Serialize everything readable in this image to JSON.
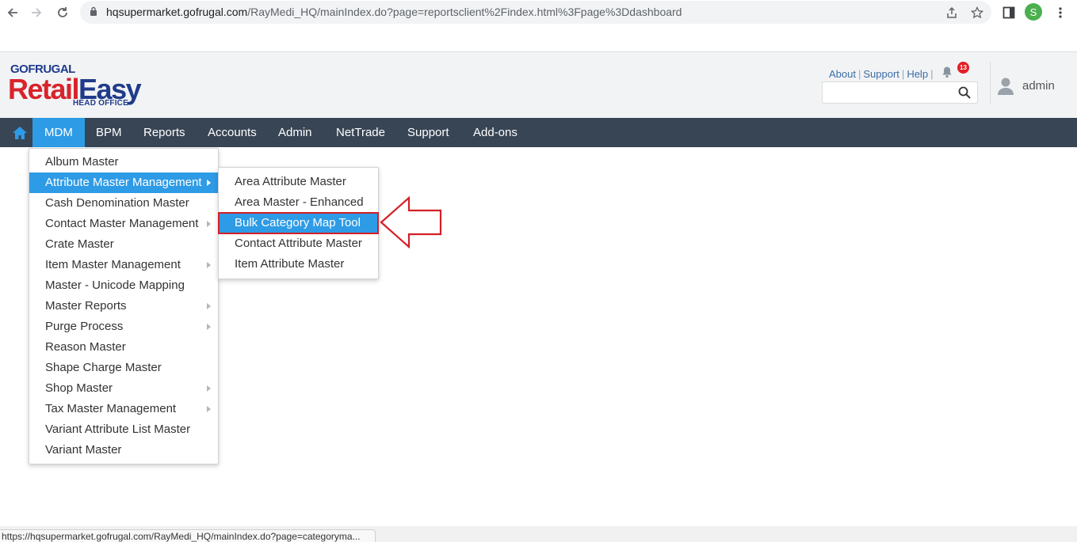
{
  "browser": {
    "url_host": "hqsupermarket.gofrugal.com",
    "url_path": "/RayMedi_HQ/mainIndex.do?page=reportsclient%2Findex.html%3Fpage%3Ddashboard",
    "profile_initial": "S",
    "status_url": "https://hqsupermarket.gofrugal.com/RayMedi_HQ/mainIndex.do?page=categoryma..."
  },
  "logo": {
    "brand_top": "GOFRUGAL",
    "brand_retail": "Retail",
    "brand_easy": "Easy",
    "brand_sub": "HEAD OFFICE"
  },
  "header": {
    "links": [
      "About",
      "Support",
      "Help"
    ],
    "notification_count": "13",
    "search_placeholder": "",
    "username": "admin"
  },
  "menu": {
    "items": [
      {
        "label": "MDM",
        "active": true
      },
      {
        "label": "BPM"
      },
      {
        "label": "Reports"
      },
      {
        "label": "Accounts"
      },
      {
        "label": "Admin"
      },
      {
        "label": "NetTrade"
      },
      {
        "label": "Support"
      },
      {
        "label": "Add-ons"
      }
    ]
  },
  "mdm_dropdown": {
    "items": [
      {
        "label": "Album Master",
        "submenu": false
      },
      {
        "label": "Attribute Master Management",
        "submenu": true,
        "highlighted": true
      },
      {
        "label": "Cash Denomination Master",
        "submenu": false
      },
      {
        "label": "Contact Master Management",
        "submenu": true
      },
      {
        "label": "Crate Master",
        "submenu": false
      },
      {
        "label": "Item Master Management",
        "submenu": true
      },
      {
        "label": "Master - Unicode Mapping",
        "submenu": false
      },
      {
        "label": "Master Reports",
        "submenu": true
      },
      {
        "label": "Purge Process",
        "submenu": true
      },
      {
        "label": "Reason Master",
        "submenu": false
      },
      {
        "label": "Shape Charge Master",
        "submenu": false
      },
      {
        "label": "Shop Master",
        "submenu": true
      },
      {
        "label": "Tax Master Management",
        "submenu": true
      },
      {
        "label": "Variant Attribute List Master",
        "submenu": false
      },
      {
        "label": "Variant Master",
        "submenu": false
      }
    ]
  },
  "attribute_submenu": {
    "items": [
      {
        "label": "Area Attribute Master"
      },
      {
        "label": "Area Master - Enhanced"
      },
      {
        "label": "Bulk Category Map Tool",
        "highlighted": true
      },
      {
        "label": "Contact Attribute Master"
      },
      {
        "label": "Item Attribute Master"
      }
    ]
  },
  "colors": {
    "menubar_bg": "#384555",
    "accent": "#2e9be6",
    "callout": "#d41f26"
  }
}
